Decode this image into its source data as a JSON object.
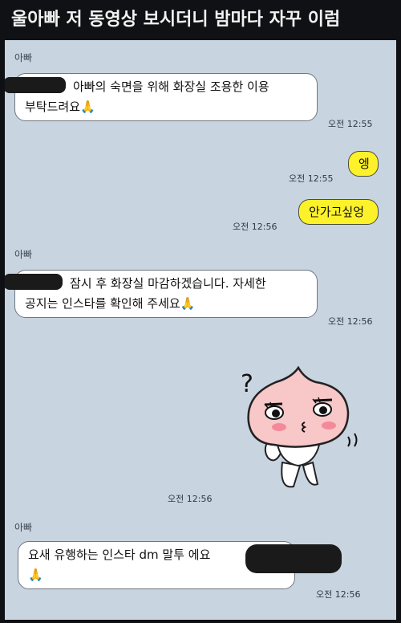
{
  "caption": "울아빠 저 동영상 보시더니 밤마다 자꾸 이럼",
  "chat": {
    "messages": [
      {
        "sender": "아빠",
        "line1": "아빠의 숙면을 위해 화장실 조용한 이용",
        "line2": "부탁드려요",
        "emoji": "🙏",
        "time": "오전 12:55"
      },
      {
        "text": "엥",
        "time": "오전 12:55"
      },
      {
        "text": "안가고싶엉",
        "time": "오전 12:56"
      },
      {
        "sender": "아빠",
        "line1": "잠시 후 화장실 마감하겠습니다. 자세한",
        "line2": "공지는 인스타를 확인해 주세요",
        "emoji": "🙏",
        "time": "오전 12:56"
      },
      {
        "sticker": "apeach-confused-sticker",
        "time": "오전 12:56"
      },
      {
        "sender": "아빠",
        "line1": "요새 유행하는 인스타 dm 말투 에요",
        "emoji": "🙏",
        "time": "오전 12:56"
      }
    ]
  },
  "colors": {
    "chat_bg": "#c8d4e0",
    "outgoing_bubble": "#fdf12a",
    "incoming_bubble": "#ffffff"
  }
}
